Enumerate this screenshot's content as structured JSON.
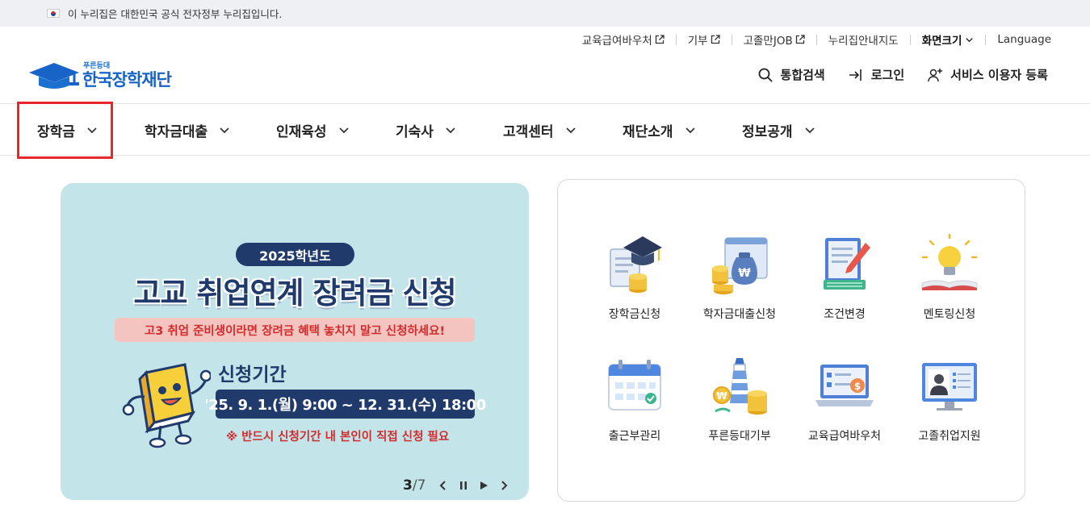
{
  "gov_banner": {
    "text": "이 누리집은 대한민국 공식 전자정부 누리집입니다."
  },
  "utility": {
    "voucher": "교육급여바우처",
    "donate": "기부",
    "job": "고졸만JOB",
    "sitemap": "누리집안내지도",
    "font_size": "화면크기",
    "language": "Language"
  },
  "logo": {
    "small": "푸른등대",
    "name": "한국장학재단"
  },
  "header": {
    "search": "통합검색",
    "login": "로그인",
    "register": "서비스 이용자 등록"
  },
  "gnb": {
    "items": [
      "장학금",
      "학자금대출",
      "인재육성",
      "기숙사",
      "고객센터",
      "재단소개",
      "정보공개"
    ],
    "active_index": 0
  },
  "banner": {
    "year": "2025학년도",
    "title": "고교 취업연계 장려금 신청",
    "subtitle": "고3 취업 준비생이라면 장려금 혜택 놓치지 말고 신청하세요!",
    "period_label": "신청기간",
    "period": "'25. 9. 1.(월) 9:00 ~ 12. 31.(수) 18:00",
    "note": "※ 반드시 신청기간 내 본인이 직접 신청 필요",
    "pager": {
      "current": "3",
      "total": "/7"
    }
  },
  "quick_menu": {
    "items": [
      {
        "label": "장학금신청",
        "icon": "graduation-cap-icon"
      },
      {
        "label": "학자금대출신청",
        "icon": "money-bag-icon"
      },
      {
        "label": "조건변경",
        "icon": "document-edit-icon"
      },
      {
        "label": "멘토링신청",
        "icon": "lightbulb-book-icon"
      },
      {
        "label": "출근부관리",
        "icon": "calendar-icon"
      },
      {
        "label": "푸른등대기부",
        "icon": "lighthouse-coins-icon"
      },
      {
        "label": "교육급여바우처",
        "icon": "voucher-laptop-icon"
      },
      {
        "label": "고졸취업지원",
        "icon": "job-profile-icon"
      }
    ]
  },
  "colors": {
    "brand": "#1763c7",
    "navy": "#1f3a6b",
    "accent_red": "#e8262c",
    "banner_bg": "#c3e4e8"
  }
}
